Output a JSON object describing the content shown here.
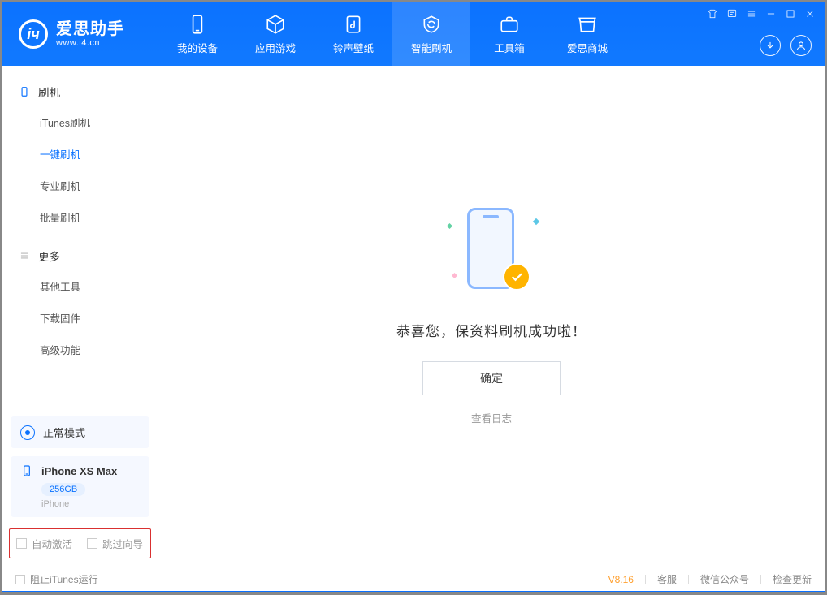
{
  "app": {
    "name_cn": "爱思助手",
    "url": "www.i4.cn"
  },
  "nav": {
    "my_device": "我的设备",
    "apps_games": "应用游戏",
    "ringtone_wallpaper": "铃声壁纸",
    "smart_flash": "智能刷机",
    "toolbox": "工具箱",
    "store": "爱思商城"
  },
  "sidebar": {
    "group_flash": "刷机",
    "items_flash": {
      "itunes": "iTunes刷机",
      "onekey": "一键刷机",
      "pro": "专业刷机",
      "batch": "批量刷机"
    },
    "group_more": "更多",
    "items_more": {
      "other_tools": "其他工具",
      "download_fw": "下载固件",
      "advanced": "高级功能"
    },
    "mode": "正常模式",
    "device": {
      "name": "iPhone XS Max",
      "capacity": "256GB",
      "type": "iPhone"
    },
    "chk_auto_activate": "自动激活",
    "chk_skip_wizard": "跳过向导"
  },
  "main": {
    "success_text": "恭喜您，保资料刷机成功啦！",
    "confirm": "确定",
    "view_log": "查看日志"
  },
  "status": {
    "block_itunes": "阻止iTunes运行",
    "version": "V8.16",
    "support": "客服",
    "wechat": "微信公众号",
    "update": "检查更新"
  }
}
